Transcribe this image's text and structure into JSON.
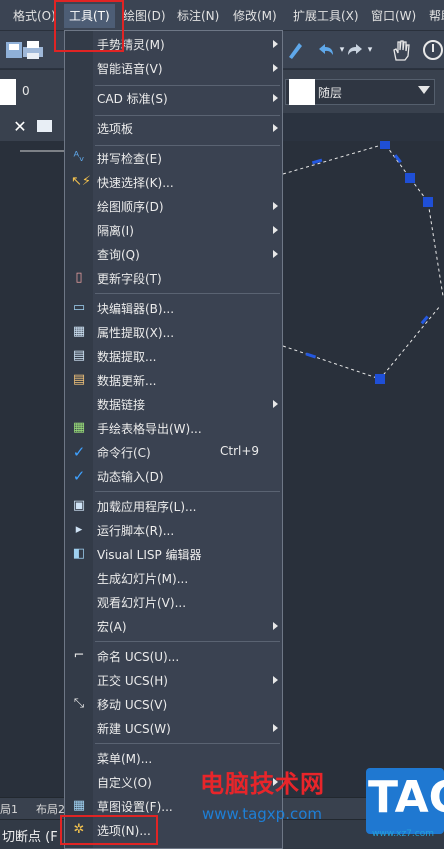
{
  "menubar": {
    "items": [
      "格式(O)",
      "工具(T)",
      "绘图(D)",
      "标注(N)",
      "修改(M)",
      "扩展工具(X)",
      "窗口(W)",
      "帮助"
    ],
    "active_index": 1
  },
  "properties": {
    "layer_value": "0",
    "linetype_value": "随层"
  },
  "tools_menu": {
    "items": [
      {
        "label": "手势精灵(M)",
        "icon": "",
        "submenu": true
      },
      {
        "label": "智能语音(V)",
        "icon": "",
        "submenu": true
      },
      {
        "label": "CAD 标准(S)",
        "icon": "",
        "submenu": true
      },
      {
        "label": "选项板",
        "icon": "",
        "submenu": true
      },
      {
        "label": "拼写检查(E)",
        "icon": "spell-check-icon",
        "submenu": false
      },
      {
        "label": "快速选择(K)...",
        "icon": "quick-select-icon",
        "submenu": false
      },
      {
        "label": "绘图顺序(D)",
        "icon": "",
        "submenu": true
      },
      {
        "label": "隔离(I)",
        "icon": "",
        "submenu": true
      },
      {
        "label": "查询(Q)",
        "icon": "",
        "submenu": true
      },
      {
        "label": "更新字段(T)",
        "icon": "update-field-icon",
        "submenu": false
      },
      {
        "label": "块编辑器(B)...",
        "icon": "block-editor-icon",
        "submenu": false
      },
      {
        "label": "属性提取(X)...",
        "icon": "attribute-extract-icon",
        "submenu": false
      },
      {
        "label": "数据提取...",
        "icon": "data-extract-icon",
        "submenu": false
      },
      {
        "label": "数据更新...",
        "icon": "data-update-icon",
        "submenu": false
      },
      {
        "label": "数据链接",
        "icon": "",
        "submenu": true
      },
      {
        "label": "手绘表格导出(W)...",
        "icon": "table-export-icon",
        "submenu": false
      },
      {
        "label": "命令行(C)",
        "icon": "checkmark-icon",
        "shortcut": "Ctrl+9",
        "submenu": false
      },
      {
        "label": "动态输入(D)",
        "icon": "checkmark-icon",
        "submenu": false
      },
      {
        "label": "加载应用程序(L)...",
        "icon": "load-app-icon",
        "submenu": false
      },
      {
        "label": "运行脚本(R)...",
        "icon": "run-script-icon",
        "submenu": false
      },
      {
        "label": "Visual LISP 编辑器",
        "icon": "lisp-editor-icon",
        "submenu": false
      },
      {
        "label": "生成幻灯片(M)...",
        "icon": "",
        "submenu": false
      },
      {
        "label": "观看幻灯片(V)...",
        "icon": "",
        "submenu": false
      },
      {
        "label": "宏(A)",
        "icon": "",
        "submenu": true
      },
      {
        "label": "命名 UCS(U)...",
        "icon": "named-ucs-icon",
        "submenu": false
      },
      {
        "label": "正交 UCS(H)",
        "icon": "",
        "submenu": true
      },
      {
        "label": "移动 UCS(V)",
        "icon": "move-ucs-icon",
        "submenu": false
      },
      {
        "label": "新建 UCS(W)",
        "icon": "",
        "submenu": true
      },
      {
        "label": "菜单(M)...",
        "icon": "",
        "submenu": false
      },
      {
        "label": "自定义(O)",
        "icon": "",
        "submenu": true
      },
      {
        "label": "草图设置(F)...",
        "icon": "drafting-settings-icon",
        "submenu": false
      },
      {
        "label": "选项(N)...",
        "icon": "gear-icon",
        "submenu": false
      }
    ]
  },
  "layout_tabs": [
    "局1",
    "布局2"
  ],
  "command_line": "切断点 (F",
  "watermark": {
    "title": "电脑技术网",
    "url": "www.tagxp.com",
    "logo": "TAG",
    "small": "www.xz7.com"
  },
  "colors": {
    "highlight_red": "#e02424",
    "canvas": "#29303b",
    "grip_blue": "#1f4fd6"
  }
}
